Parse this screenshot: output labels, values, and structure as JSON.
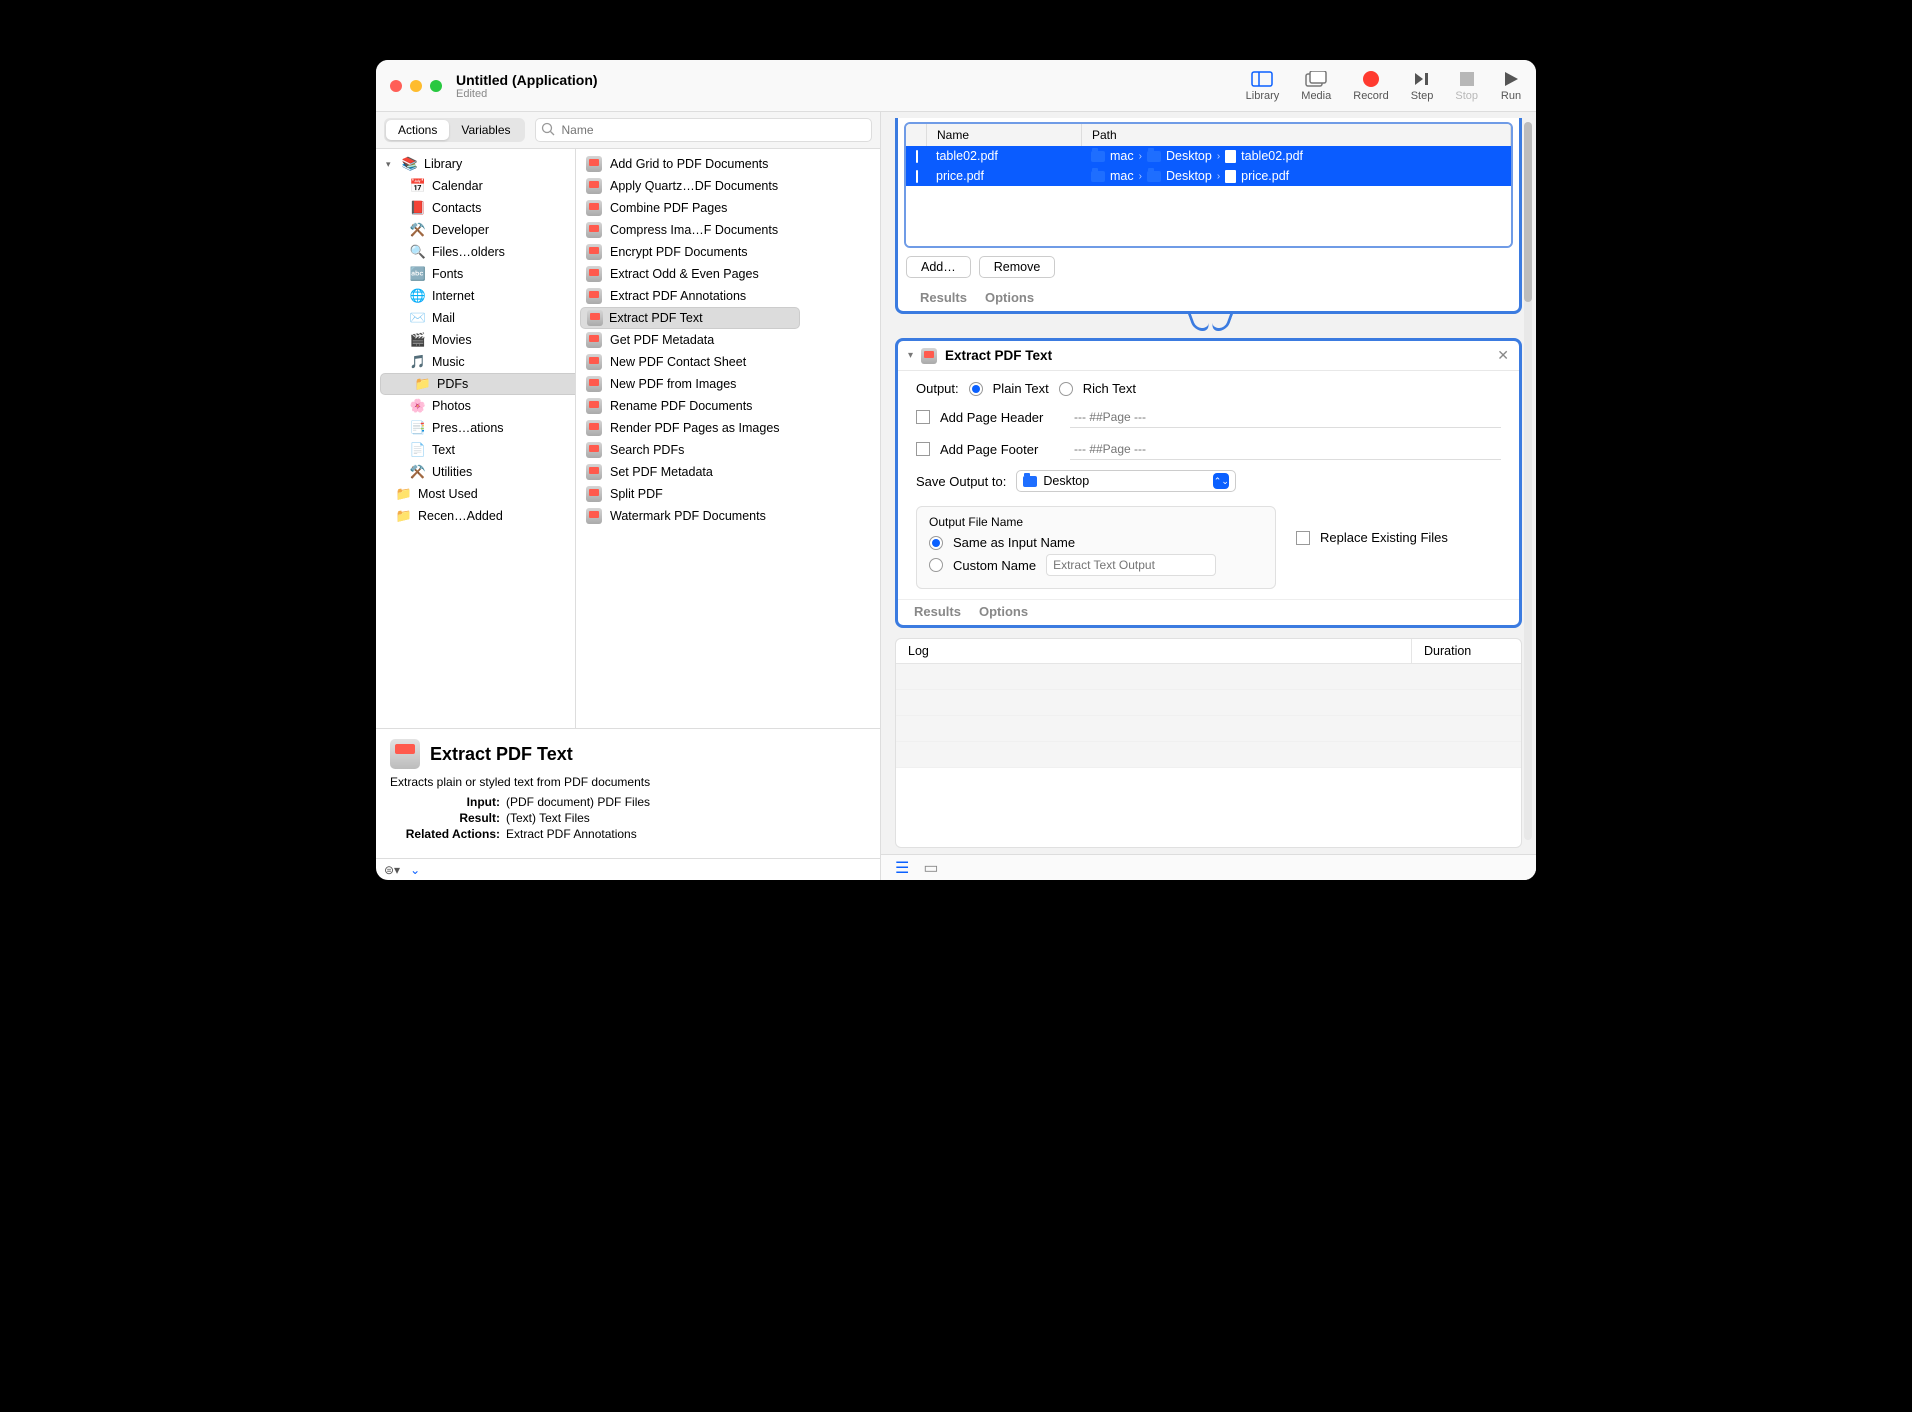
{
  "title": "Untitled (Application)",
  "subtitle": "Edited",
  "toolbar": {
    "library": "Library",
    "media": "Media",
    "record": "Record",
    "step": "Step",
    "stop": "Stop",
    "run": "Run"
  },
  "tabs": {
    "actions": "Actions",
    "variables": "Variables"
  },
  "search_placeholder": "Name",
  "tree": {
    "root": "Library",
    "items": [
      "Calendar",
      "Contacts",
      "Developer",
      "Files…olders",
      "Fonts",
      "Internet",
      "Mail",
      "Movies",
      "Music",
      "PDFs",
      "Photos",
      "Pres…ations",
      "Text",
      "Utilities"
    ],
    "extra": [
      "Most Used",
      "Recen…Added"
    ],
    "selected": "PDFs"
  },
  "actions": {
    "list": [
      "Add Grid to PDF Documents",
      "Apply Quartz…DF Documents",
      "Combine PDF Pages",
      "Compress Ima…F Documents",
      "Encrypt PDF Documents",
      "Extract Odd & Even Pages",
      "Extract PDF Annotations",
      "Extract PDF Text",
      "Get PDF Metadata",
      "New PDF Contact Sheet",
      "New PDF from Images",
      "Rename PDF Documents",
      "Render PDF Pages as Images",
      "Search PDFs",
      "Set PDF Metadata",
      "Split PDF",
      "Watermark PDF Documents"
    ],
    "selected": "Extract PDF Text"
  },
  "info": {
    "title": "Extract PDF Text",
    "desc": "Extracts plain or styled text from PDF documents",
    "input_k": "Input:",
    "input_v": "(PDF document) PDF Files",
    "result_k": "Result:",
    "result_v": "(Text) Text Files",
    "related_k": "Related Actions:",
    "related_v": "Extract PDF Annotations"
  },
  "wf_files": {
    "cols": {
      "name": "Name",
      "path": "Path"
    },
    "rows": [
      {
        "name": "table02.pdf",
        "p1": "mac",
        "p2": "Desktop",
        "p3": "table02.pdf"
      },
      {
        "name": "price.pdf",
        "p1": "mac",
        "p2": "Desktop",
        "p3": "price.pdf"
      }
    ],
    "add": "Add…",
    "remove": "Remove",
    "results": "Results",
    "options": "Options"
  },
  "wf_extract": {
    "title": "Extract PDF Text",
    "output_label": "Output:",
    "plain": "Plain Text",
    "rich": "Rich Text",
    "addheader": "Add Page Header",
    "addfooter": "Add Page Footer",
    "pageplaceholder": "--- ##Page ---",
    "save_label": "Save Output to:",
    "save_value": "Desktop",
    "ofn": "Output File Name",
    "same": "Same as Input Name",
    "custom": "Custom Name",
    "custom_ph": "Extract Text Output",
    "replace": "Replace Existing Files",
    "results": "Results",
    "options": "Options"
  },
  "log": {
    "col1": "Log",
    "col2": "Duration"
  }
}
